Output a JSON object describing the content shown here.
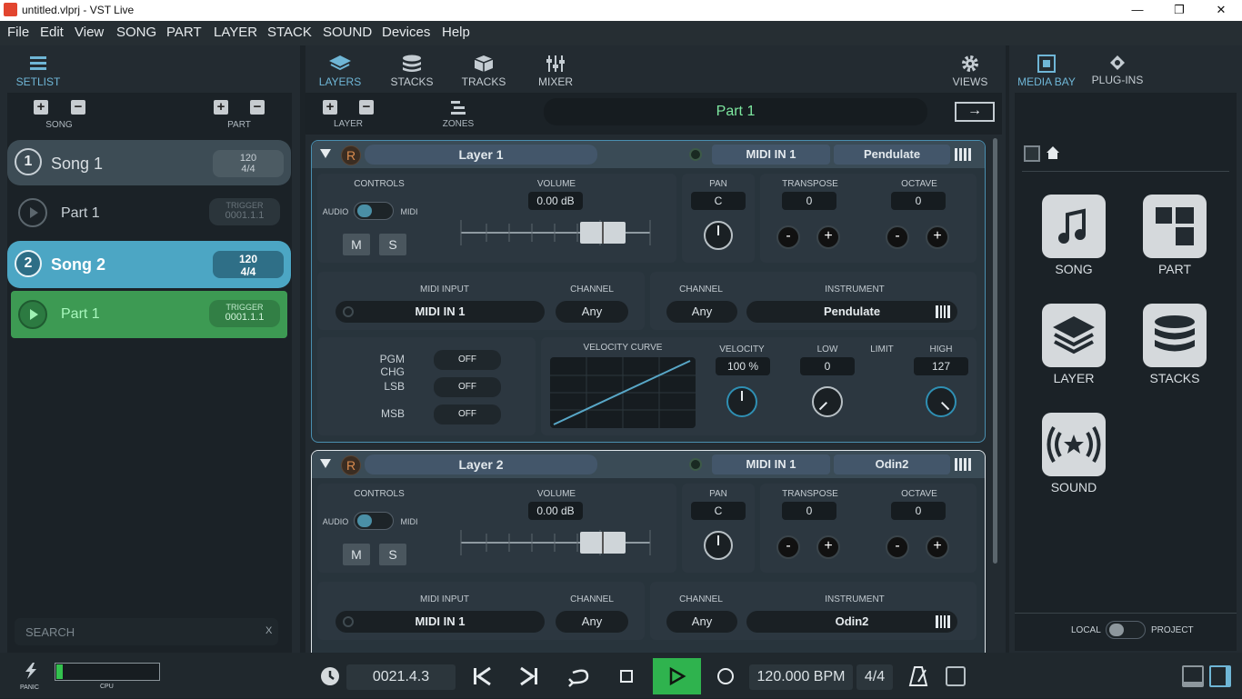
{
  "window": {
    "title": "untitled.vlprj - VST Live",
    "min": "—",
    "max": "❐",
    "close": "✕"
  },
  "menu": [
    "File",
    "Edit",
    "View",
    "SONG",
    "PART",
    "LAYER",
    "STACK",
    "SOUND",
    "Devices",
    "Help"
  ],
  "left": {
    "setlist_label": "SETLIST",
    "song_label": "SONG",
    "part_label": "PART",
    "songs": [
      {
        "num": "1",
        "name": "Song 1",
        "tempo": "120",
        "sig": "4/4",
        "part": "Part 1",
        "trigger": "TRIGGER",
        "pos": "0001.1.1"
      },
      {
        "num": "2",
        "name": "Song 2",
        "tempo": "120",
        "sig": "4/4",
        "part": "Part 1",
        "trigger": "TRIGGER",
        "pos": "0001.1.1"
      }
    ],
    "search_placeholder": "SEARCH",
    "search_clear": "X"
  },
  "center": {
    "tabs": [
      "LAYERS",
      "STACKS",
      "TRACKS",
      "MIXER"
    ],
    "views": "VIEWS",
    "layer_label": "LAYER",
    "zones_label": "ZONES",
    "part_name": "Part 1",
    "arrow": "→",
    "layers": [
      {
        "name": "Layer 1",
        "r": "R",
        "midi_in": "MIDI IN 1",
        "instrument": "Pendulate",
        "controls": "CONTROLS",
        "audio": "AUDIO",
        "midi": "MIDI",
        "m": "M",
        "s": "S",
        "volume_label": "VOLUME",
        "volume": "0.00 dB",
        "pan_label": "PAN",
        "pan": "C",
        "transpose_label": "TRANSPOSE",
        "transpose": "0",
        "octave_label": "OCTAVE",
        "octave": "0",
        "midi_input_label": "MIDI INPUT",
        "channel_label": "CHANNEL",
        "channel": "Any",
        "instrument_label": "INSTRUMENT",
        "pgm": "PGM CHG",
        "lsb": "LSB",
        "msb": "MSB",
        "off": "OFF",
        "vel_curve": "VELOCITY CURVE",
        "velocity_label": "VELOCITY",
        "velocity": "100 %",
        "low_label": "LOW",
        "low": "0",
        "limit": "LIMIT",
        "high_label": "HIGH",
        "high": "127"
      },
      {
        "name": "Layer 2",
        "r": "R",
        "midi_in": "MIDI IN 1",
        "instrument": "Odin2",
        "controls": "CONTROLS",
        "audio": "AUDIO",
        "midi": "MIDI",
        "m": "M",
        "s": "S",
        "volume_label": "VOLUME",
        "volume": "0.00 dB",
        "pan_label": "PAN",
        "pan": "C",
        "transpose_label": "TRANSPOSE",
        "transpose": "0",
        "octave_label": "OCTAVE",
        "octave": "0",
        "midi_input_label": "MIDI INPUT",
        "channel_label": "CHANNEL",
        "channel": "Any",
        "instrument_label": "INSTRUMENT"
      }
    ]
  },
  "right": {
    "tabs": [
      "MEDIA BAY",
      "PLUG-INS"
    ],
    "items": [
      "SONG",
      "PART",
      "LAYER",
      "STACKS",
      "SOUND"
    ],
    "local": "LOCAL",
    "project": "PROJECT"
  },
  "transport": {
    "panic": "PANIC",
    "cpu": "CPU",
    "cpu_load": 0.06,
    "position": "0021.4.3",
    "tempo": "120.000 BPM",
    "sig": "4/4"
  },
  "colors": {
    "accent": "#4aa3c4",
    "green": "#3aa655",
    "play": "#2fb34e"
  }
}
